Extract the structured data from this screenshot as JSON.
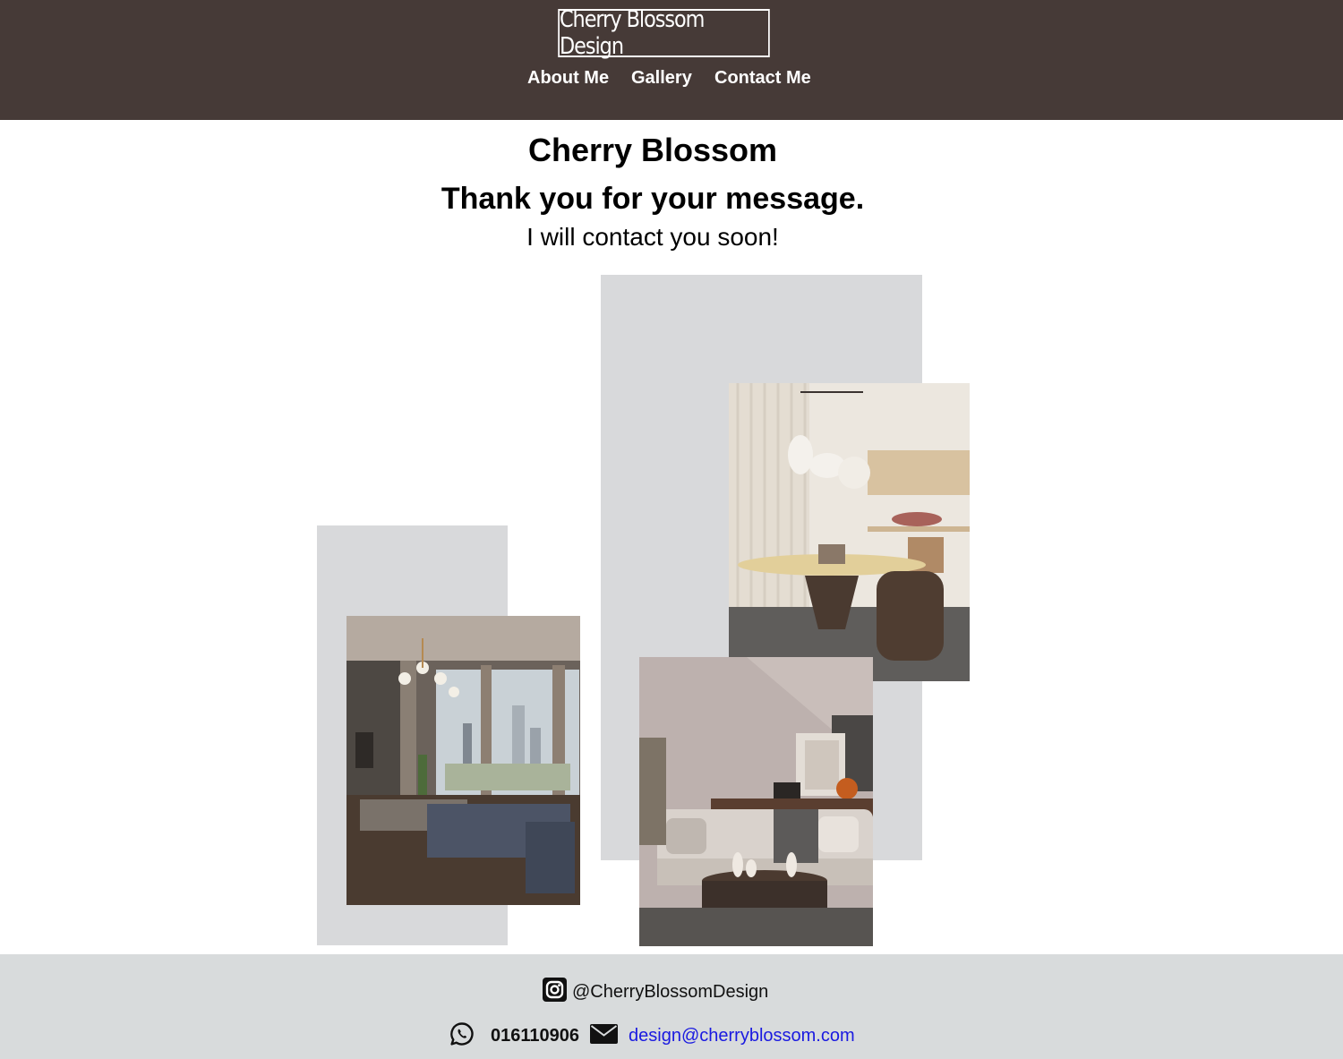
{
  "header": {
    "logo_text": "Cherry Blossom Design",
    "nav": [
      {
        "label": "About Me"
      },
      {
        "label": "Gallery"
      },
      {
        "label": "Contact Me"
      }
    ],
    "background_color": "#463a37"
  },
  "main": {
    "brand_heading": "Cherry Blossom",
    "thanks_heading": "Thank you for your message.",
    "followup_text": "I will contact you soon!"
  },
  "gallery": {
    "images": [
      {
        "icon": "living-room-photo"
      },
      {
        "icon": "dining-room-photo"
      },
      {
        "icon": "sofa-lounge-photo"
      }
    ],
    "panel_color": "#d8d9db"
  },
  "footer": {
    "instagram_handle": "@CherryBlossomDesign",
    "phone": "016110906",
    "email": "design@cherryblossom.com",
    "icons": [
      "instagram-icon",
      "whatsapp-icon",
      "envelope-icon"
    ],
    "background_color": "#d8dbdc",
    "link_color": "#1a1ae0"
  }
}
